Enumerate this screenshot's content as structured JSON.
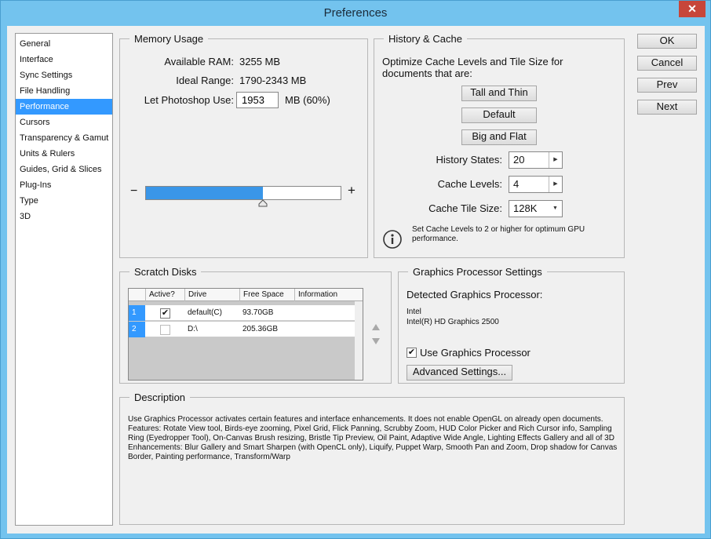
{
  "window": {
    "title": "Preferences",
    "close_glyph": "✕"
  },
  "categories": [
    {
      "label": "General"
    },
    {
      "label": "Interface"
    },
    {
      "label": "Sync Settings"
    },
    {
      "label": "File Handling"
    },
    {
      "label": "Performance",
      "selected": true
    },
    {
      "label": "Cursors"
    },
    {
      "label": "Transparency & Gamut"
    },
    {
      "label": "Units & Rulers"
    },
    {
      "label": "Guides, Grid & Slices"
    },
    {
      "label": "Plug-Ins"
    },
    {
      "label": "Type"
    },
    {
      "label": "3D"
    }
  ],
  "memory": {
    "legend": "Memory Usage",
    "available_label": "Available RAM:",
    "available_value": "3255 MB",
    "ideal_label": "Ideal Range:",
    "ideal_value": "1790-2343 MB",
    "let_label": "Let Photoshop Use:",
    "let_value": "1953",
    "let_suffix": "MB (60%)",
    "minus": "−",
    "plus": "+",
    "slider_fraction": 0.6
  },
  "history": {
    "legend": "History & Cache",
    "intro": "Optimize Cache Levels and Tile Size for documents that are:",
    "btn_tall": "Tall and Thin",
    "btn_default": "Default",
    "btn_big": "Big and Flat",
    "states_label": "History States:",
    "states_value": "20",
    "levels_label": "Cache Levels:",
    "levels_value": "4",
    "tile_label": "Cache Tile Size:",
    "tile_value": "128K",
    "info_text": "Set Cache Levels to 2 or higher for optimum GPU performance."
  },
  "scratch": {
    "legend": "Scratch Disks",
    "columns": [
      "Active?",
      "Drive",
      "Free Space",
      "Information"
    ],
    "rows": [
      {
        "num": "1",
        "active": true,
        "drive": "default(C)",
        "free": "93.70GB",
        "info": ""
      },
      {
        "num": "2",
        "active": false,
        "drive": "D:\\",
        "free": "205.36GB",
        "info": ""
      }
    ]
  },
  "gpu": {
    "legend": "Graphics Processor Settings",
    "detected_label": "Detected Graphics Processor:",
    "vendor": "Intel",
    "model": "Intel(R) HD Graphics 2500",
    "use_label": "Use Graphics Processor",
    "use_checked": true,
    "advanced_label": "Advanced Settings..."
  },
  "description": {
    "legend": "Description",
    "text": "Use Graphics Processor activates certain features and interface enhancements. It does not enable OpenGL on already open documents.\nFeatures: Rotate View tool, Birds-eye zooming, Pixel Grid, Flick Panning, Scrubby Zoom, HUD Color Picker and Rich Cursor info, Sampling Ring (Eyedropper Tool), On-Canvas Brush resizing, Bristle Tip Preview, Oil Paint, Adaptive Wide Angle, Lighting Effects Gallery and all of 3D\nEnhancements: Blur Gallery and Smart Sharpen (with OpenCL only), Liquify, Puppet Warp, Smooth Pan and Zoom, Drop shadow for Canvas Border, Painting performance, Transform/Warp"
  },
  "buttons": {
    "ok": "OK",
    "cancel": "Cancel",
    "prev": "Prev",
    "next": "Next"
  },
  "colors": {
    "selection": "#3399ff",
    "slider_fill": "#3a96e8",
    "titlebar": "#73c3ee",
    "close": "#c7463a"
  }
}
